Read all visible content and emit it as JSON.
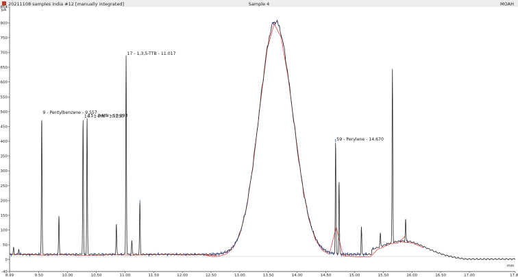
{
  "window": {
    "title": "20211108 samples india #12 [manually integrated]",
    "sample": "Sample 4",
    "mode": "MOAH"
  },
  "chart_data": {
    "type": "line",
    "title": "Sample 4",
    "ylabel": "pA",
    "xlabel": "min",
    "xlim": [
      8.99,
      17.8
    ],
    "ylim": [
      -40,
      854
    ],
    "x_ticks": [
      "8.99",
      "9.50",
      "10.00",
      "10.50",
      "11.00",
      "11.50",
      "12.00",
      "12.50",
      "13.00",
      "13.50",
      "14.00",
      "14.50",
      "15.00",
      "15.50",
      "16.00",
      "16.50",
      "17.00",
      "17.80"
    ],
    "y_ticks": [
      "-40",
      "0",
      "50",
      "100",
      "150",
      "200",
      "250",
      "300",
      "350",
      "400",
      "450",
      "500",
      "550",
      "600",
      "650",
      "700",
      "750",
      "800",
      "854"
    ],
    "hump": {
      "apex_min": 13.62,
      "apex_pa": 805,
      "baseline_pa": 18
    },
    "peaks": [
      {
        "time": 9.06,
        "height": 40
      },
      {
        "time": 9.15,
        "height": 36
      },
      {
        "time": 9.55,
        "height": 490,
        "label": "9 - Pentylbenzene - 9.557"
      },
      {
        "time": 9.85,
        "height": 150
      },
      {
        "time": 10.27,
        "height": 478,
        "label": "14 - 1-MN - 10.230"
      },
      {
        "time": 10.34,
        "height": 480,
        "label": "15 - 2-MN - 10.293"
      },
      {
        "time": 10.85,
        "height": 122
      },
      {
        "time": 11.02,
        "height": 690,
        "label": "17 - 1,3,5-TTB - 11.017"
      },
      {
        "time": 11.12,
        "height": 65
      },
      {
        "time": 11.26,
        "height": 195
      },
      {
        "time": 14.67,
        "height": 400,
        "label": "59 - Perylene - 14.670"
      },
      {
        "time": 14.73,
        "height": 265
      },
      {
        "time": 15.12,
        "height": 110
      },
      {
        "time": 15.45,
        "height": 90
      },
      {
        "time": 15.66,
        "height": 645
      },
      {
        "time": 15.89,
        "height": 137
      }
    ]
  }
}
